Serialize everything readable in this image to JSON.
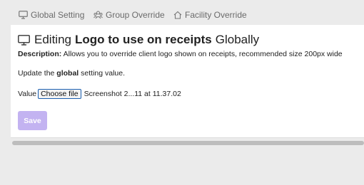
{
  "tabs": [
    {
      "label": "Global Setting",
      "icon": "monitor-icon"
    },
    {
      "label": "Group Override",
      "icon": "group-icon"
    },
    {
      "label": "Facility Override",
      "icon": "home-icon"
    }
  ],
  "panel": {
    "title_prefix": "Editing",
    "title_strong": "Logo to use on receipts",
    "title_suffix": "Globally",
    "description_label": "Description:",
    "description_text": "Allows you to override client logo shown on receipts, recommended size 200px wide",
    "update_prefix": "Update the",
    "update_strong": "global",
    "update_suffix": "setting value.",
    "value_label": "Value",
    "choose_file_label": "Choose file",
    "file_name": "Screenshot 2...11 at 11.37.02",
    "save_label": "Save"
  },
  "colors": {
    "save_button": "#c3b3f1",
    "focus_border": "#1b5fb0",
    "tab_text": "#6b6b6b",
    "background": "#ebebeb"
  }
}
